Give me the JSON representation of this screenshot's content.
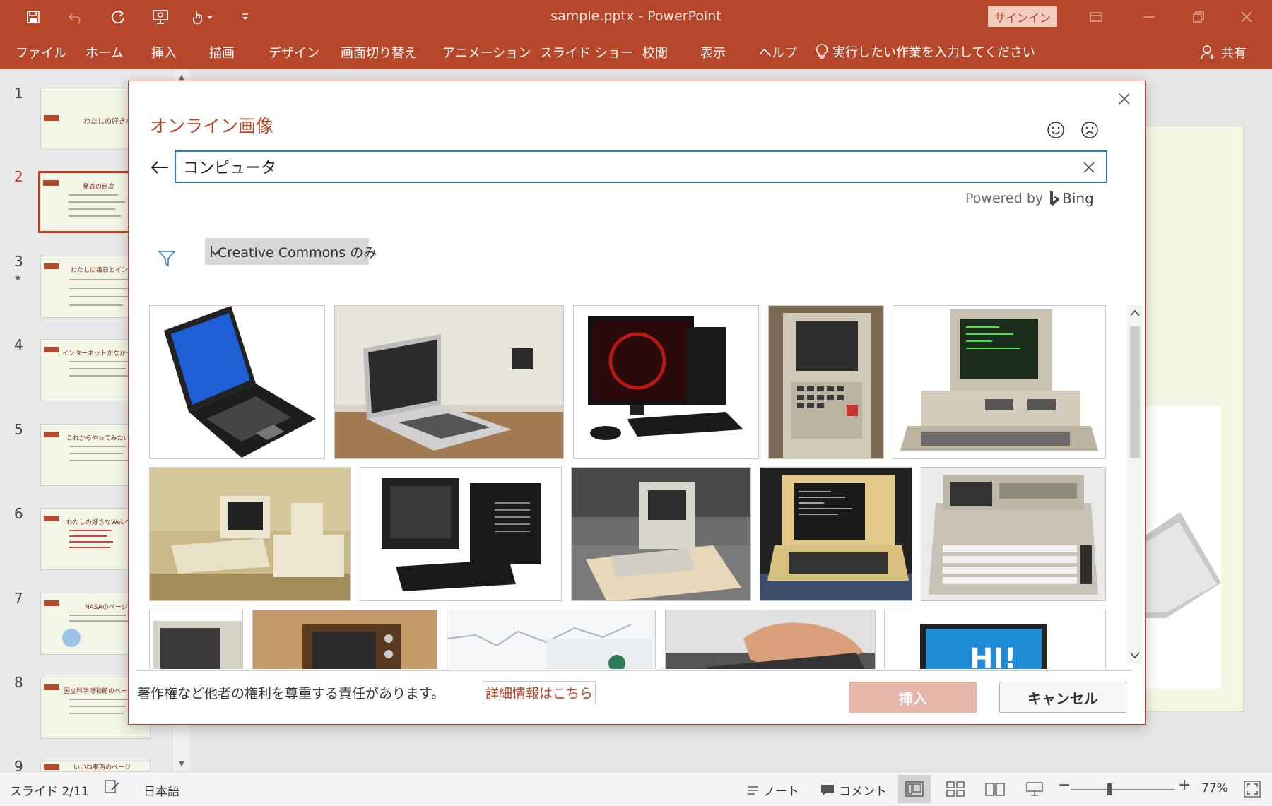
{
  "app": {
    "doc_title": "sample.pptx  -  PowerPoint",
    "signin_label": "サインイン"
  },
  "ribbon": {
    "tabs": [
      "ファイル",
      "ホーム",
      "挿入",
      "描画",
      "デザイン",
      "画面切り替え",
      "アニメーション",
      "スライド ショー",
      "校閲",
      "表示",
      "ヘルプ"
    ],
    "tell_me": "実行したい作業を入力してください",
    "share": "共有"
  },
  "slides": {
    "numbers": [
      "1",
      "2",
      "3",
      "4",
      "5",
      "6",
      "7",
      "8",
      "9"
    ],
    "current": 2,
    "thumb_titles": [
      "わたしの好きなWebページ",
      "発表の目次",
      "わたしの毎日とインターネ",
      "インターネットがなかったら",
      "これからやってみたい",
      "わたしの好きなWebペー",
      "NASAのページ",
      "国立科学博物館のページ",
      "いいね東西のページ"
    ]
  },
  "dialog": {
    "title": "オンライン画像",
    "search_value": "コンピュータ",
    "powered_by": "Powered by",
    "bing": "Bing",
    "cc_filter_label": "Creative Commons のみ",
    "cc_filter_checked": true,
    "notice": "著作権など他者の権利を尊重する責任があります。",
    "more_link": "詳細情報はこちら",
    "insert_label": "挿入",
    "cancel_label": "キャンセル",
    "results_visible": 15
  },
  "statusbar": {
    "slide_info": "スライド 2/11",
    "language": "日本語",
    "notes": "ノート",
    "comments": "コメント",
    "zoom": "77%"
  },
  "colors": {
    "brand": "#b7472a",
    "search_focus": "#2b79d0",
    "insert_disabled": "#e6b6aa"
  }
}
